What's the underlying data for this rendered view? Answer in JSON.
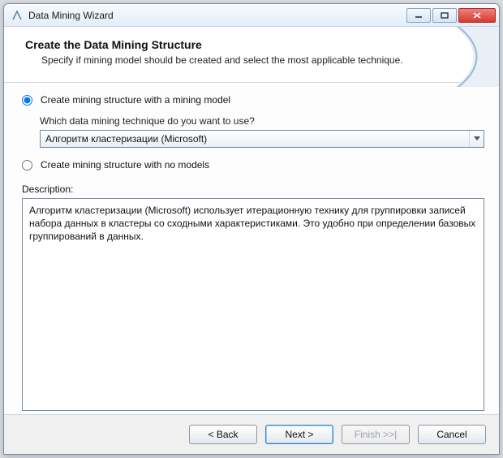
{
  "window": {
    "title": "Data Mining Wizard"
  },
  "header": {
    "title": "Create the Data Mining Structure",
    "subtitle": "Specify if mining model should be created and select the most applicable technique."
  },
  "options": {
    "with_model_label": "Create mining structure with a mining  model",
    "no_model_label": "Create mining structure with no models",
    "selected": "with_model",
    "technique_prompt": "Which data mining technique do you want to use?",
    "technique_selected": "Алгоритм кластеризации (Microsoft)"
  },
  "description": {
    "label": "Description:",
    "text": "Алгоритм кластеризации (Microsoft) использует итерационную технику для группировки записей набора данных в кластеры со сходными характеристиками. Это удобно при определении базовых группирований в данных."
  },
  "footer": {
    "back": "< Back",
    "next": "Next >",
    "finish": "Finish >>|",
    "cancel": "Cancel"
  }
}
